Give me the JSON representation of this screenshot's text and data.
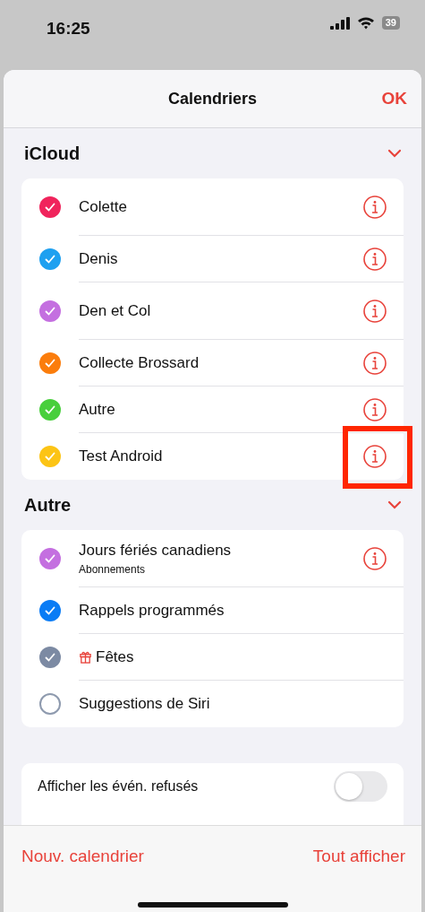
{
  "status_bar": {
    "time": "16:25",
    "battery": "39"
  },
  "header": {
    "title": "Calendriers",
    "done": "OK"
  },
  "sections": [
    {
      "title": "iCloud",
      "expanded": true,
      "calendars": [
        {
          "name": "Colette",
          "color": "#f0245c",
          "checked": true,
          "info": true,
          "gift": false,
          "highlighted": false
        },
        {
          "name": "Denis",
          "color": "#1ea0f0",
          "checked": true,
          "info": true,
          "gift": false,
          "highlighted": false
        },
        {
          "name": "Den et Col",
          "color": "#c46fe0",
          "checked": true,
          "info": true,
          "gift": false,
          "highlighted": false
        },
        {
          "name": "Collecte Brossard",
          "color": "#fb7d0c",
          "checked": true,
          "info": true,
          "gift": false,
          "highlighted": false
        },
        {
          "name": "Autre",
          "color": "#48cf3c",
          "checked": true,
          "info": true,
          "gift": false,
          "highlighted": false
        },
        {
          "name": "Test Android",
          "color": "#fcc415",
          "checked": true,
          "info": true,
          "gift": false,
          "highlighted": true
        }
      ]
    },
    {
      "title": "Autre",
      "expanded": true,
      "calendars": [
        {
          "name": "Jours fériés canadiens",
          "subtitle": "Abonnements",
          "color": "#c46fe0",
          "checked": true,
          "info": true,
          "gift": false,
          "highlighted": false
        },
        {
          "name": "Rappels programmés",
          "color": "#0a7cf5",
          "checked": true,
          "info": false,
          "gift": false,
          "highlighted": false
        },
        {
          "name": "Fêtes",
          "color": "#7c8aa3",
          "checked": true,
          "info": false,
          "gift": true,
          "highlighted": false
        },
        {
          "name": "Suggestions de Siri",
          "color": "#8e9aae",
          "checked": false,
          "info": false,
          "gift": false,
          "highlighted": false
        }
      ]
    }
  ],
  "settings": [
    {
      "label": "Afficher les évén. refusés",
      "on": false
    }
  ],
  "footer": {
    "left": "Nouv. calendrier",
    "right": "Tout afficher"
  }
}
